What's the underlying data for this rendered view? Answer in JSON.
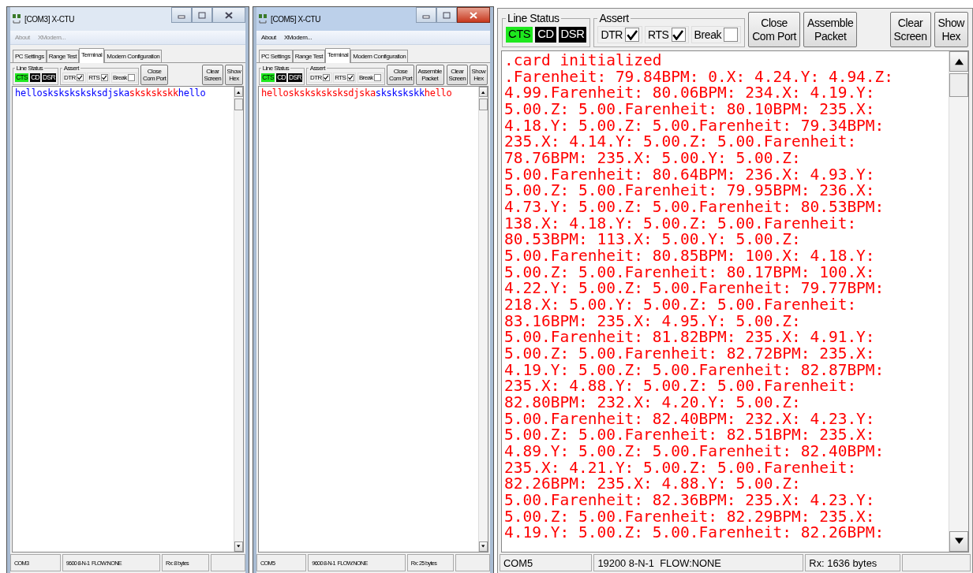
{
  "windows": [
    {
      "title": "[COM3] X-CTU",
      "active": false,
      "menu": [
        {
          "label": "About"
        },
        {
          "label": "XModem..."
        }
      ],
      "tabs": [
        {
          "label": "PC Settings",
          "selected": false
        },
        {
          "label": "Range Test",
          "selected": false
        },
        {
          "label": "Terminal",
          "selected": true
        },
        {
          "label": "Modem Configuration",
          "selected": false
        }
      ],
      "line_status": {
        "label": "Line Status",
        "signals": [
          {
            "label": "CTS",
            "on": true
          },
          {
            "label": "CD",
            "on": false
          },
          {
            "label": "DSR",
            "on": false
          }
        ]
      },
      "assert": {
        "label": "Assert",
        "items": [
          {
            "label": "DTR",
            "checked": true
          },
          {
            "label": "RTS",
            "checked": true
          },
          {
            "label": "Break",
            "checked": false
          }
        ]
      },
      "buttons": [
        {
          "lines": [
            "Close",
            "Com Port"
          ]
        },
        {
          "lines": [
            "Clear",
            "Screen"
          ]
        },
        {
          "lines": [
            "Show",
            "Hex"
          ]
        }
      ],
      "terminal": [
        {
          "text": "hellosksksksksksdjska",
          "color": "#0000ff"
        },
        {
          "text": "skskskskk",
          "color": "#ff0000"
        },
        {
          "text": "hello",
          "color": "#0000ff"
        }
      ],
      "status_bar": [
        "COM3",
        "9600 8-N-1  FLOW:NONE",
        "Rx: 8 bytes"
      ]
    },
    {
      "title": "[COM5] X-CTU",
      "active": true,
      "menu": [
        {
          "label": "About"
        },
        {
          "label": "XModem..."
        }
      ],
      "tabs": [
        {
          "label": "PC Settings",
          "selected": false
        },
        {
          "label": "Range Test",
          "selected": false
        },
        {
          "label": "Terminal",
          "selected": true
        },
        {
          "label": "Modem Configuration",
          "selected": false
        }
      ],
      "line_status": {
        "label": "Line Status",
        "signals": [
          {
            "label": "CTS",
            "on": true
          },
          {
            "label": "CD",
            "on": false
          },
          {
            "label": "DSR",
            "on": false
          }
        ]
      },
      "assert": {
        "label": "Assert",
        "items": [
          {
            "label": "DTR",
            "checked": true
          },
          {
            "label": "RTS",
            "checked": true
          },
          {
            "label": "Break",
            "checked": false
          }
        ]
      },
      "buttons": [
        {
          "lines": [
            "Close",
            "Com Port"
          ]
        },
        {
          "lines": [
            "Assemble",
            "Packet"
          ]
        },
        {
          "lines": [
            "Clear",
            "Screen"
          ]
        },
        {
          "lines": [
            "Show",
            "Hex"
          ]
        }
      ],
      "terminal": [
        {
          "text": "hellosksksksksksdjska",
          "color": "#ff0000"
        },
        {
          "text": "skskskskk",
          "color": "#0000ff"
        },
        {
          "text": "hello",
          "color": "#ff0000"
        }
      ],
      "status_bar": [
        "COM5",
        "9600 8-N-1  FLOW:NONE",
        "Rx: 25 bytes"
      ]
    },
    {
      "line_status": {
        "label": "Line Status",
        "signals": [
          {
            "label": "CTS",
            "on": true
          },
          {
            "label": "CD",
            "on": false
          },
          {
            "label": "DSR",
            "on": false
          }
        ]
      },
      "assert": {
        "label": "Assert",
        "items": [
          {
            "label": "DTR",
            "checked": true
          },
          {
            "label": "RTS",
            "checked": true
          },
          {
            "label": "Break",
            "checked": false
          }
        ]
      },
      "buttons": [
        {
          "lines": [
            "Close",
            "Com Port"
          ]
        },
        {
          "lines": [
            "Assemble",
            "Packet"
          ]
        },
        {
          "lines": [
            "Clear",
            "Screen"
          ]
        },
        {
          "lines": [
            "Show",
            "Hex"
          ]
        }
      ],
      "terminal_lines": [
        ".card initialized",
        ".Farenheit: 79.84BPM: 0.X: 4.24.Y: 4.94.Z:",
        "4.99.Farenheit: 80.06BPM: 234.X: 4.19.Y:",
        "5.00.Z: 5.00.Farenheit: 80.10BPM: 235.X:",
        "4.18.Y: 5.00.Z: 5.00.Farenheit: 79.34BPM:",
        "235.X: 4.14.Y: 5.00.Z: 5.00.Farenheit:",
        "78.76BPM: 235.X: 5.00.Y: 5.00.Z:",
        "5.00.Farenheit: 80.64BPM: 236.X: 4.93.Y:",
        "5.00.Z: 5.00.Farenheit: 79.95BPM: 236.X:",
        "4.73.Y: 5.00.Z: 5.00.Farenheit: 80.53BPM:",
        "138.X: 4.18.Y: 5.00.Z: 5.00.Farenheit:",
        "80.53BPM: 113.X: 5.00.Y: 5.00.Z:",
        "5.00.Farenheit: 80.85BPM: 100.X: 4.18.Y:",
        "5.00.Z: 5.00.Farenheit: 80.17BPM: 100.X:",
        "4.22.Y: 5.00.Z: 5.00.Farenheit: 79.77BPM:",
        "218.X: 5.00.Y: 5.00.Z: 5.00.Farenheit:",
        "83.16BPM: 235.X: 4.95.Y: 5.00.Z:",
        "5.00.Farenheit: 81.82BPM: 235.X: 4.91.Y:",
        "5.00.Z: 5.00.Farenheit: 82.72BPM: 235.X:",
        "4.19.Y: 5.00.Z: 5.00.Farenheit: 82.87BPM:",
        "235.X: 4.88.Y: 5.00.Z: 5.00.Farenheit:",
        "82.80BPM: 232.X: 4.20.Y: 5.00.Z:",
        "5.00.Farenheit: 82.40BPM: 232.X: 4.23.Y:",
        "5.00.Z: 5.00.Farenheit: 82.51BPM: 235.X:",
        "4.89.Y: 5.00.Z: 5.00.Farenheit: 82.40BPM:",
        "235.X: 4.21.Y: 5.00.Z: 5.00.Farenheit:",
        "82.26BPM: 235.X: 4.88.Y: 5.00.Z:",
        "5.00.Farenheit: 82.36BPM: 235.X: 4.23.Y:",
        "5.00.Z: 5.00.Farenheit: 82.29BPM: 235.X:",
        "4.19.Y: 5.00.Z: 5.00.Farenheit: 82.26BPM:"
      ],
      "status_bar": [
        "COM5",
        "19200 8-N-1  FLOW:NONE",
        "Rx: 1636 bytes"
      ]
    }
  ]
}
